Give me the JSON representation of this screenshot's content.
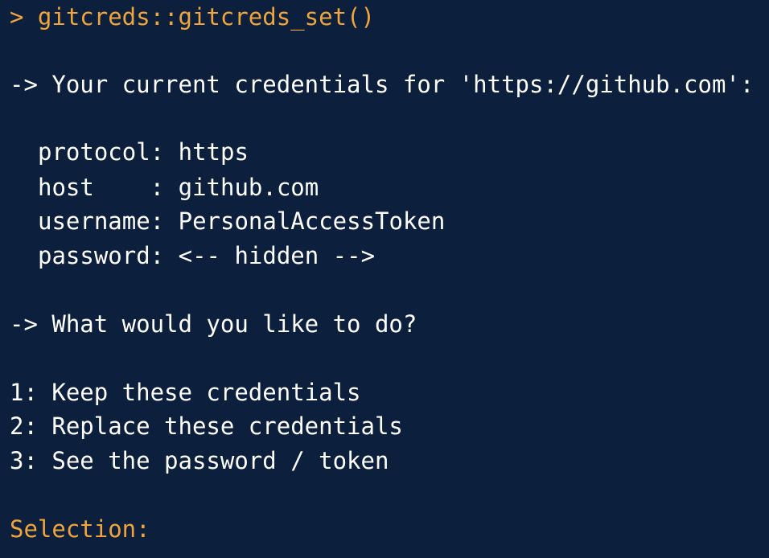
{
  "terminal": {
    "colors": {
      "background": "#0c1f3d",
      "text": "#ffffff",
      "accent": "#f0a53c"
    },
    "command": "> gitcreds::gitcreds_set()",
    "current_credentials_msg": "-> Your current credentials for 'https://github.com':",
    "credentials": [
      {
        "key": "protocol: ",
        "value": "https"
      },
      {
        "key": "host    : ",
        "value": "github.com"
      },
      {
        "key": "username: ",
        "value": "PersonalAccessToken"
      },
      {
        "key": "password: ",
        "value": "<-- hidden -->"
      }
    ],
    "question": "-> What would you like to do?",
    "options": [
      "1: Keep these credentials",
      "2: Replace these credentials",
      "3: See the password / token"
    ],
    "prompt": "Selection:"
  }
}
